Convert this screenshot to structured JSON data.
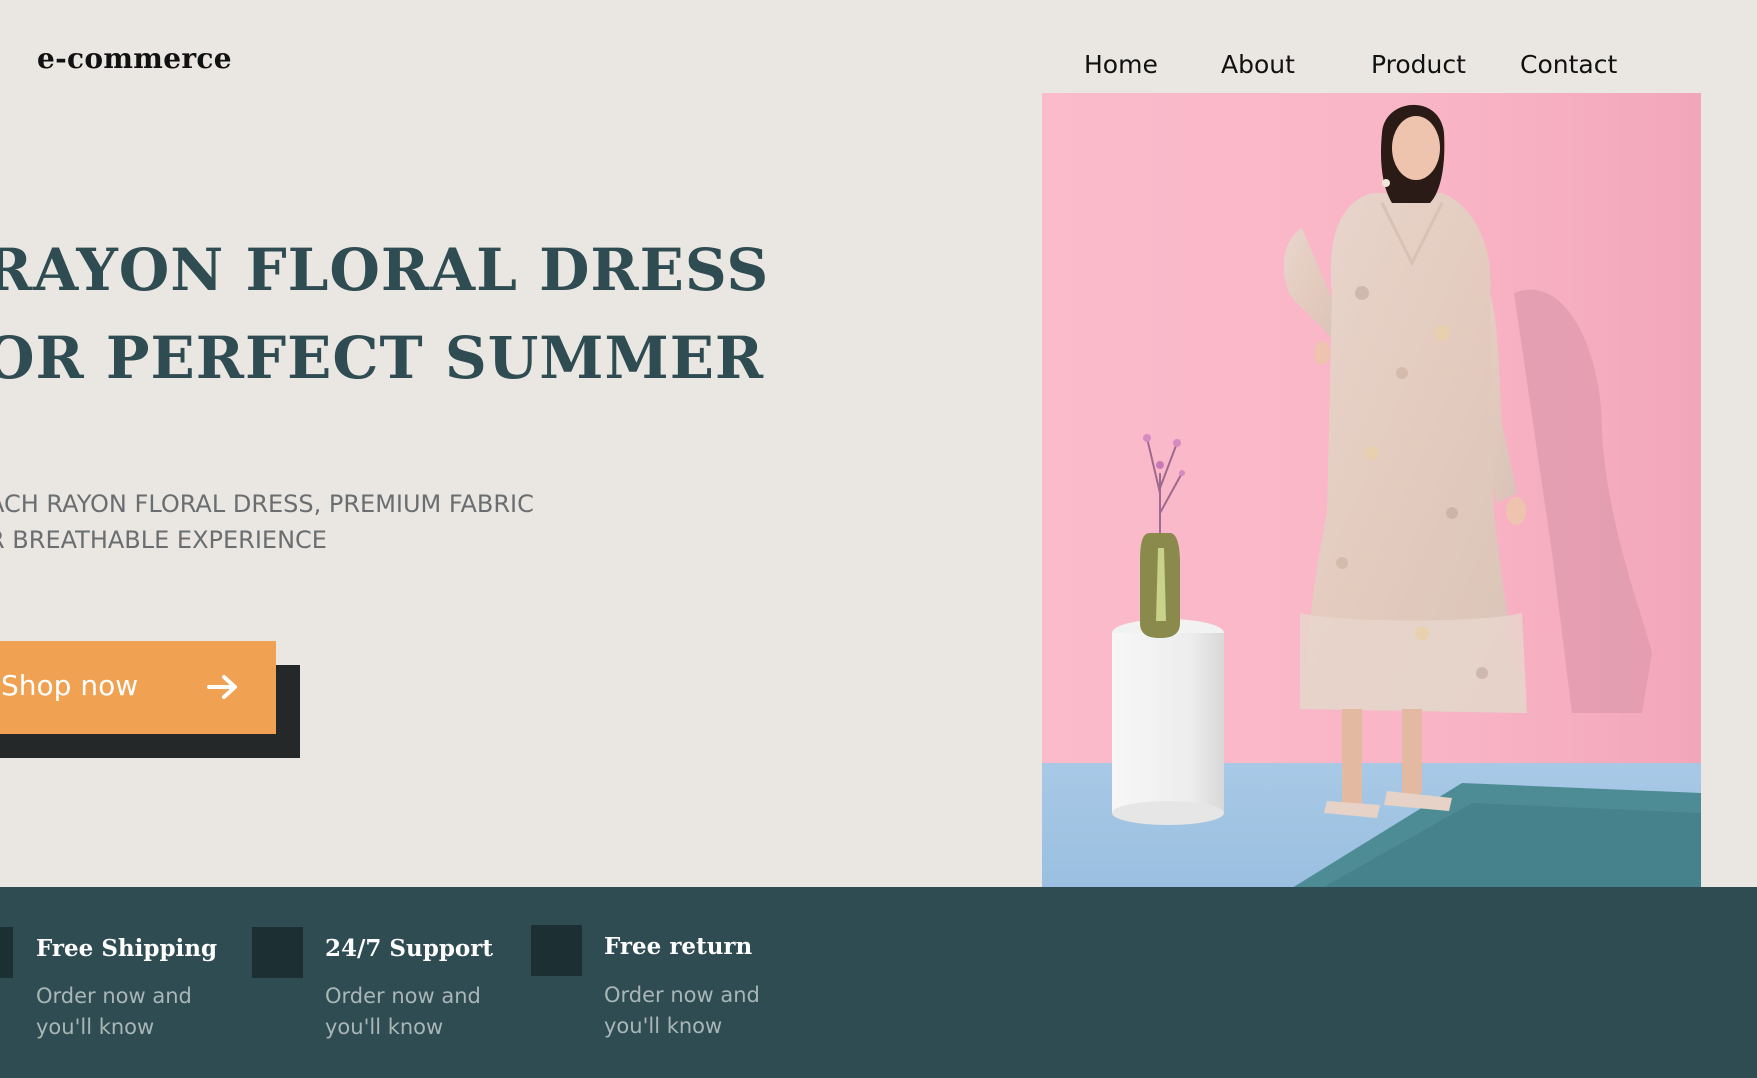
{
  "header": {
    "logo": "e-commerce",
    "nav": [
      "Home",
      "About",
      "Product",
      "Contact"
    ]
  },
  "hero": {
    "title_lines": [
      "RAYON FLORAL DRESS",
      "OR PERFECT SUMMER"
    ],
    "subtitle_lines": [
      "ACH RAYON FLORAL DRESS, PREMIUM FABRIC",
      "R BREATHABLE EXPERIENCE"
    ],
    "cta_label": "Shop now",
    "cta_icon": "arrow-right-icon"
  },
  "features": [
    {
      "title": "Free Shipping",
      "text_lines": [
        "Order now and",
        "you'll know"
      ]
    },
    {
      "title": "24/7 Support",
      "text_lines": [
        "Order now and",
        "you'll know"
      ]
    },
    {
      "title": "Free return",
      "text_lines": [
        "Order now and",
        "you'll know"
      ]
    }
  ],
  "colors": {
    "background": "#EAE7E2",
    "heading": "#2F4C52",
    "accent": "#F0A152",
    "footer_band": "#2F4C52",
    "feature_icon": "#1C2F33"
  }
}
